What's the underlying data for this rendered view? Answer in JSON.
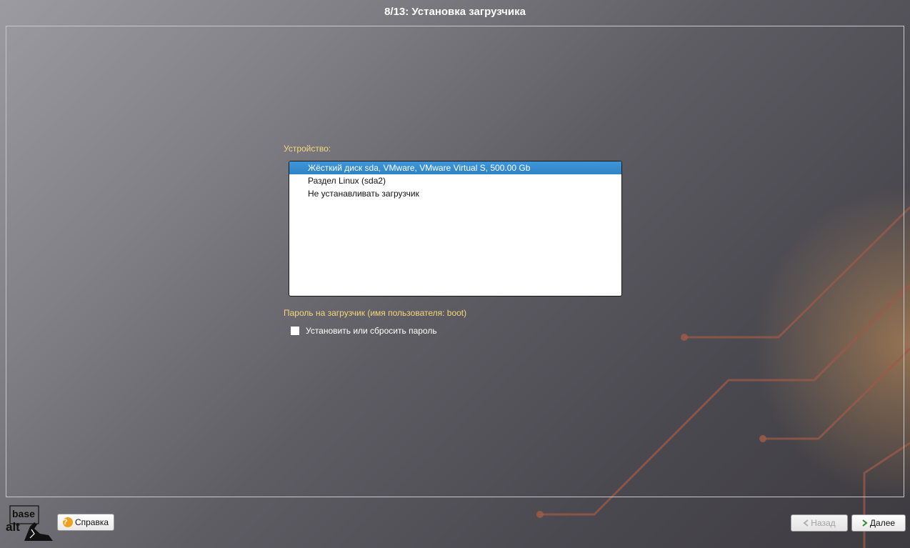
{
  "window": {
    "title": "8/13: Установка загрузчика"
  },
  "device": {
    "label": "Устройство:",
    "items": [
      {
        "label": "Жёсткий диск sda, VMware, VMware Virtual S, 500.00 Gb",
        "selected": true
      },
      {
        "label": "Раздел Linux (sda2)",
        "selected": false
      },
      {
        "label": "Не устанавливать загрузчик",
        "selected": false
      }
    ]
  },
  "password": {
    "label": "Пароль на загрузчик (имя пользователя: boot)",
    "checkbox_label": "Установить или сбросить пароль",
    "checked": false
  },
  "footer": {
    "logo_text": [
      "base",
      "alt"
    ],
    "help_label": "Справка",
    "back_label": "Назад",
    "next_label": "Далее"
  },
  "colors": {
    "section_label": "#f5d77a",
    "selection": "#3e95d8",
    "help_icon": "#f0a020",
    "next_arrow": "#2e8b2e"
  },
  "icons": [
    "help-icon",
    "back-arrow-icon",
    "next-arrow-icon",
    "checkbox-icon",
    "basealt-logo"
  ]
}
